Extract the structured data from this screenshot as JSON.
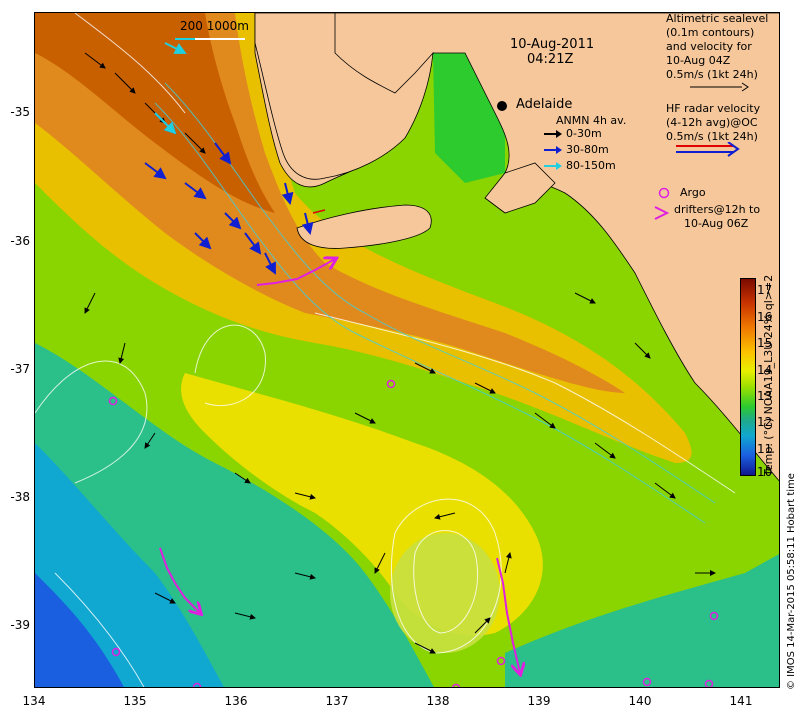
{
  "title": {
    "date": "10-Aug-2011",
    "time": "04:21Z"
  },
  "city": "Adelaide",
  "scale_label": "200  1000m",
  "legend": {
    "altimetry_lines": [
      "Altimetric sealevel",
      "(0.1m contours)",
      "and velocity for",
      "10-Aug 04Z",
      "0.5m/s (1kt 24h)"
    ],
    "hf_radar_lines": [
      "HF radar velocity",
      "(4-12h avg)@OC",
      "0.5m/s (1kt 24h)"
    ],
    "anmn_title": "ANMN 4h av.",
    "anmn_items": [
      {
        "label": "0-30m",
        "color": "#000000"
      },
      {
        "label": "30-80m",
        "color": "#1020d0"
      },
      {
        "label": "80-150m",
        "color": "#20d0e0"
      }
    ],
    "argo_label": "Argo",
    "drifters_lines": [
      "drifters@12h to",
      "10-Aug 06Z"
    ]
  },
  "axes": {
    "x_ticks": [
      "134",
      "135",
      "136",
      "137",
      "138",
      "139",
      "140",
      "141"
    ],
    "y_ticks": [
      "-35",
      "-36",
      "-37",
      "-38",
      "-39"
    ]
  },
  "colorbar": {
    "ticks": [
      "17",
      "16",
      "15",
      "14",
      "13",
      "12",
      "11",
      "10"
    ],
    "label": "Temp. (°C) NOAA19_L3U 24% ql>=2",
    "colors": [
      "#7a0a00",
      "#c83200",
      "#f07a00",
      "#fbc000",
      "#e9f000",
      "#9ce000",
      "#2ecb2e",
      "#1faa8a",
      "#10a8d0",
      "#1a5fe0",
      "#101890"
    ]
  },
  "credit": "© IMOS 14-Mar-2015 05:58:11 Hobart time",
  "colors": {
    "land": "#f5c79a",
    "sst_warm": "#e08a1e",
    "sst_mid": "#8ad400",
    "sst_cool": "#2bbf8a",
    "argo": "#e020e0",
    "hf_red": "#e00000",
    "hf_blue": "#1020d0"
  }
}
